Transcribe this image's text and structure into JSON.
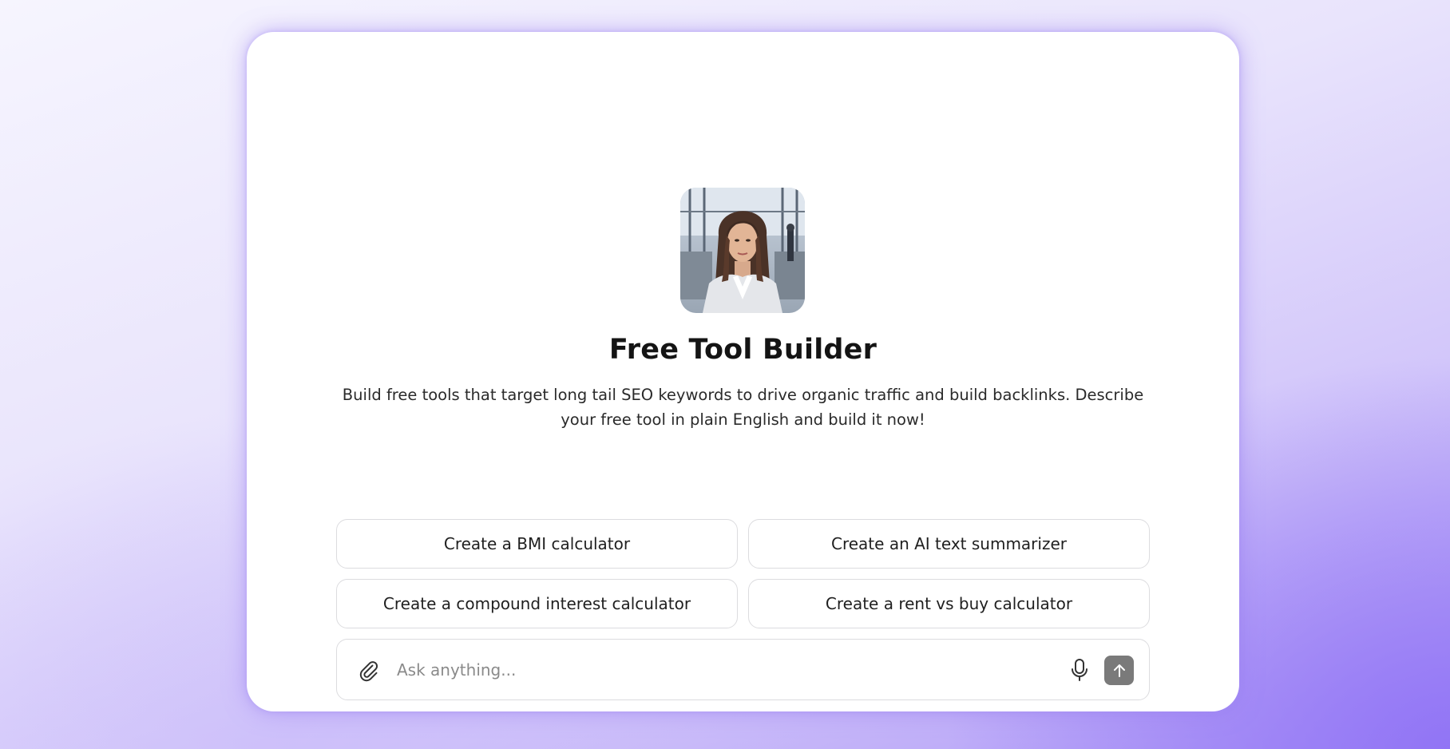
{
  "header": {
    "title": "Free Tool Builder",
    "description": "Build free tools that target long tail SEO keywords to drive organic traffic and build backlinks. Describe your free tool in plain English and build it now!"
  },
  "avatar": {
    "icon": "businesswoman-avatar"
  },
  "suggestions": [
    {
      "label": "Create a BMI calculator"
    },
    {
      "label": "Create an AI text summarizer"
    },
    {
      "label": "Create a compound interest calculator"
    },
    {
      "label": "Create a rent vs buy calculator"
    }
  ],
  "composer": {
    "placeholder": "Ask anything...",
    "attach_icon": "paperclip-icon",
    "mic_icon": "microphone-icon",
    "send_icon": "arrow-up-icon"
  },
  "colors": {
    "accent": "#9b82f5",
    "send_button": "#7a7a7a",
    "text": "#141414"
  }
}
